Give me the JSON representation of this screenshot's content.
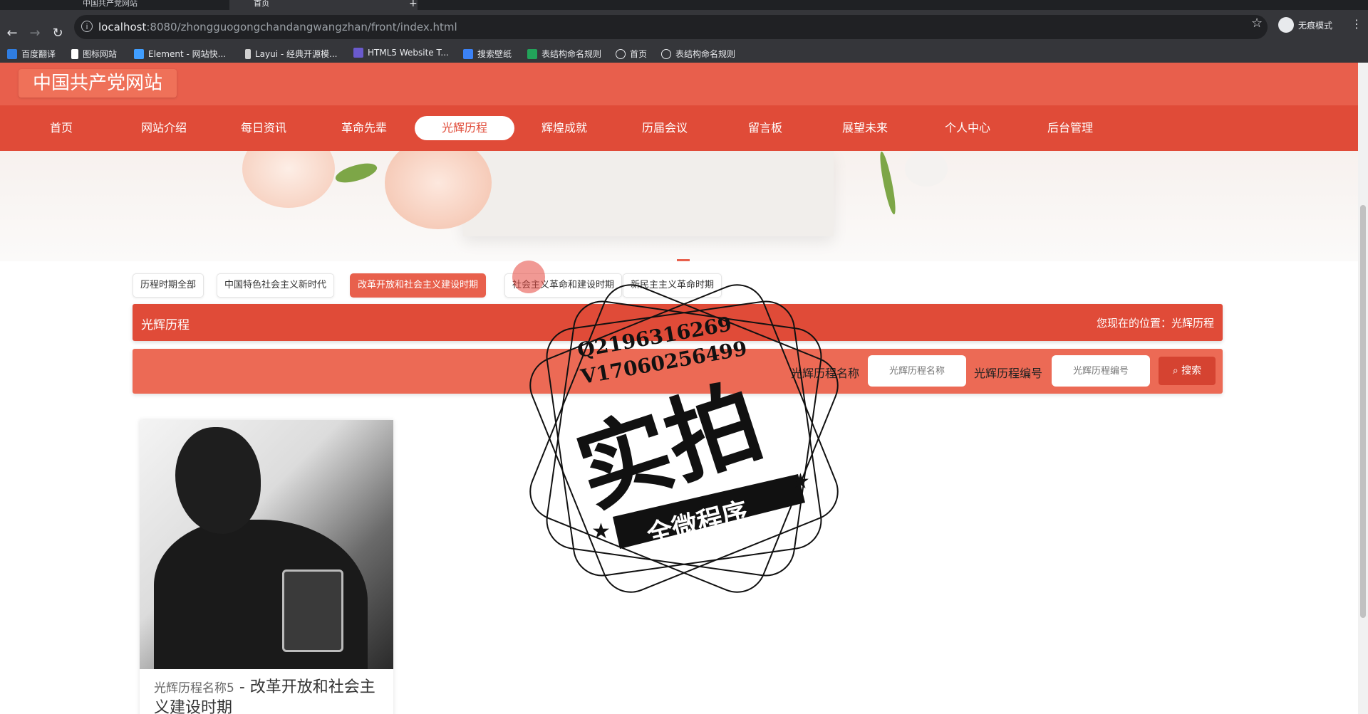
{
  "browser": {
    "tabs": [
      {
        "title": "中国共产党网站",
        "active": false
      },
      {
        "title": "首页",
        "active": true
      }
    ],
    "url_host": "localhost",
    "url_rest": ":8080/zhongguogongchandangwangzhan/front/index.html",
    "profile_label": "无痕模式",
    "bookmarks": [
      {
        "label": "百度翻译",
        "color": "#2f7de1"
      },
      {
        "label": "图标网站",
        "color": "#ffffff"
      },
      {
        "label": "Element - 网站快...",
        "color": "#409eff"
      },
      {
        "label": "Layui - 经典开源模...",
        "color": "#d0d0d0"
      },
      {
        "label": "HTML5 Website T...",
        "color": "#6a5acd"
      },
      {
        "label": "搜索壁纸",
        "color": "#3b82f6"
      },
      {
        "label": "表结构命名规则",
        "color": "#22a35a"
      },
      {
        "label": "首页",
        "color": "#e8eaed"
      },
      {
        "label": "表结构命名规则",
        "color": "#e8eaed"
      }
    ]
  },
  "site": {
    "title": "中国共产党网站",
    "nav": [
      {
        "label": "首页",
        "active": false
      },
      {
        "label": "网站介绍",
        "active": false
      },
      {
        "label": "每日资讯",
        "active": false
      },
      {
        "label": "革命先辈",
        "active": false
      },
      {
        "label": "光辉历程",
        "active": true
      },
      {
        "label": "辉煌成就",
        "active": false
      },
      {
        "label": "历届会议",
        "active": false
      },
      {
        "label": "留言板",
        "active": false
      },
      {
        "label": "展望未来",
        "active": false
      },
      {
        "label": "个人中心",
        "active": false
      },
      {
        "label": "后台管理",
        "active": false
      }
    ],
    "accent": "#e04b38"
  },
  "filters": [
    {
      "label": "历程时期全部",
      "active": false
    },
    {
      "label": "中国特色社会主义新时代",
      "active": false
    },
    {
      "label": "改革开放和社会主义建设时期",
      "active": true
    },
    {
      "label": "社会主义革命和建设时期",
      "active": false
    },
    {
      "label": "新民主主义革命时期",
      "active": false
    }
  ],
  "section": {
    "title": "光辉历程",
    "location": "您现在的位置：光辉历程"
  },
  "search": {
    "name_label": "光辉历程名称",
    "name_placeholder": "光辉历程名称",
    "code_label": "光辉历程编号",
    "code_placeholder": "光辉历程编号",
    "button_label": "搜索"
  },
  "cards": [
    {
      "name": "光辉历程名称5",
      "period": " - 改革开放和社会主义建设时期"
    }
  ],
  "watermark": {
    "line1": "Q2196316269",
    "line2": "V17060256499",
    "big": "实拍",
    "ribbon": "全微程序"
  }
}
